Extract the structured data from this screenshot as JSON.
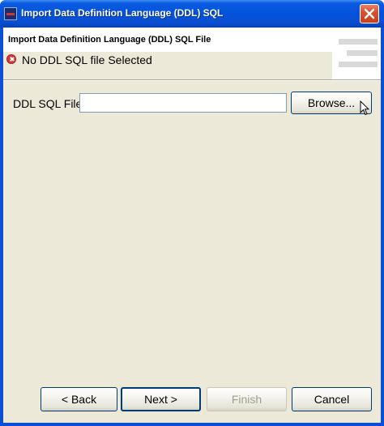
{
  "window": {
    "title": "Import Data Definition Language (DDL) SQL",
    "app_icon": "app-icon",
    "close_icon": "close-icon"
  },
  "banner": {
    "title": "Import Data Definition Language (DDL) SQL File",
    "message": "No DDL SQL file Selected",
    "message_icon": "error-icon"
  },
  "form": {
    "file_label": "DDL SQL File",
    "file_value": "",
    "browse_label": "Browse..."
  },
  "buttons": {
    "back": "< Back",
    "next": "Next >",
    "finish": "Finish",
    "cancel": "Cancel"
  },
  "colors": {
    "titlebar": "#0353dc",
    "dialog_bg": "#ece9d8",
    "error": "#d83a3a"
  }
}
